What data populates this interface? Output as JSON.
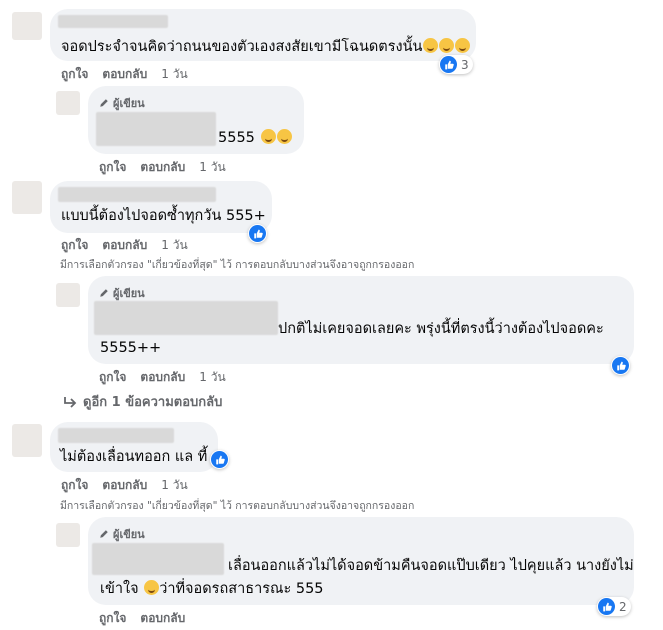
{
  "comments": [
    {
      "text": "จอดประจำจนคิดว่าถนนของตัวเองสงสัยเขามีโฉนดตรงนั้น",
      "emoji_count": 3,
      "like_count": "3",
      "actions": {
        "like": "ถูกใจ",
        "reply": "ตอบกลับ",
        "time": "1 วัน"
      }
    },
    {
      "author_label": "ผู้เขียน",
      "text": "5555",
      "emoji_count": 2,
      "actions": {
        "like": "ถูกใจ",
        "reply": "ตอบกลับ",
        "time": "1 วัน"
      }
    },
    {
      "text": "แบบนี้ต้องไปจอดซ้ำทุกวัน 555+",
      "actions": {
        "like": "ถูกใจ",
        "reply": "ตอบกลับ",
        "time": "1 วัน"
      },
      "filter_note": "มีการเลือกตัวกรอง \"เกี่ยวข้องที่สุด\" ไว้ การตอบกลับบางส่วนจึงอาจถูกกรองออก"
    },
    {
      "author_label": "ผู้เขียน",
      "text_line1": "ปกติไม่เคยจอดเลยคะ พรุ่งนี้ที่ตรงนี้ว่างต้องไปจอดคะ",
      "text_line2": "5555++",
      "actions": {
        "like": "ถูกใจ",
        "reply": "ตอบกลับ",
        "time": "1 วัน"
      },
      "more_replies": "ดูอีก 1 ข้อความตอบกลับ"
    },
    {
      "text": "ไม่ต้องเลื่อนทออก แล ที้",
      "actions": {
        "like": "ถูกใจ",
        "reply": "ตอบกลับ",
        "time": "1 วัน"
      },
      "filter_note": "มีการเลือกตัวกรอง \"เกี่ยวข้องที่สุด\" ไว้ การตอบกลับบางส่วนจึงอาจถูกกรองออก"
    },
    {
      "author_label": "ผู้เขียน",
      "text_line1": "เลื่อนออกแล้วไม่ได้จอดข้ามคืนจอดแป๊บเดียว ไปคุยแล้ว นางยังไม่",
      "text_line2_a": "เข้าใจ",
      "text_line2_b": "ว่าที่จอดรถสาธารณะ 555",
      "like_count": "2",
      "actions": {
        "like": "ถูกใจ",
        "reply": "ตอบกลับ"
      }
    }
  ]
}
